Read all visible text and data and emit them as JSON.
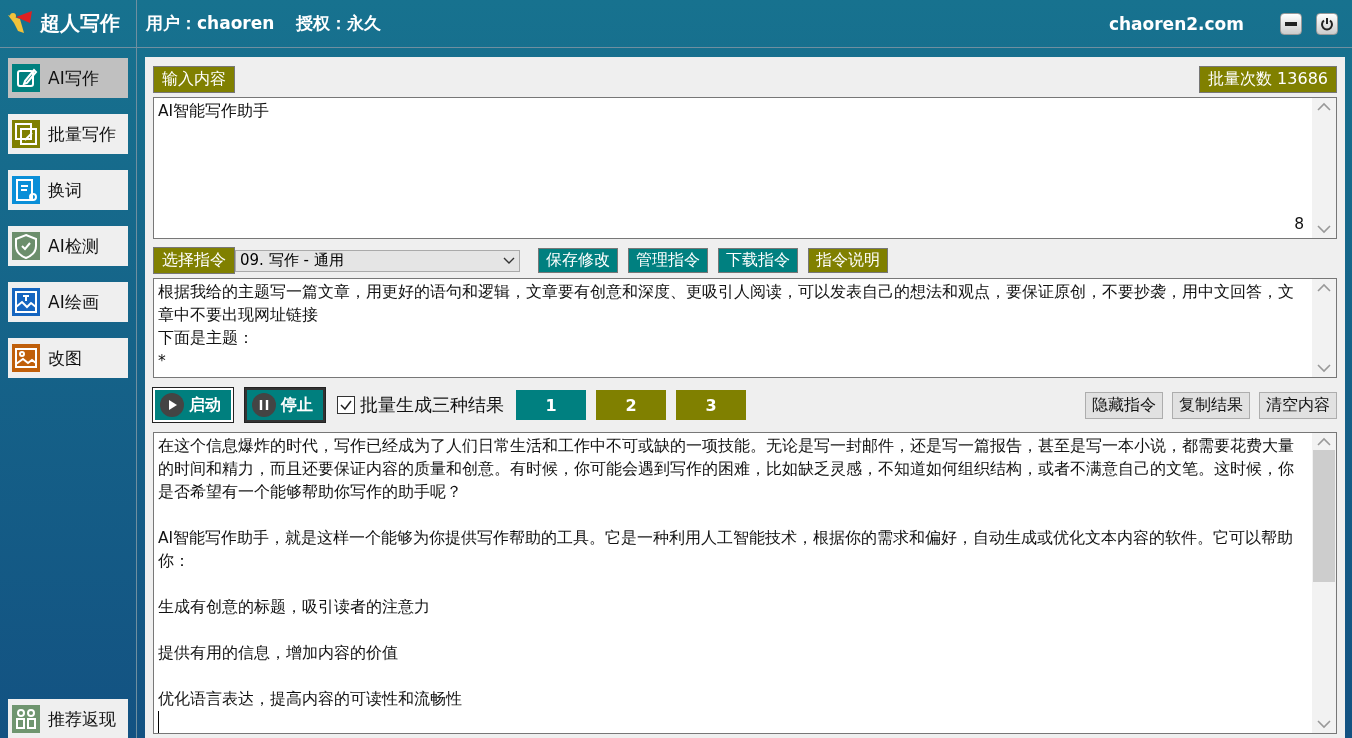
{
  "header": {
    "app_name": "超人写作",
    "user": "用户：chaoren",
    "license": "授权：永久",
    "site": "chaoren2.com"
  },
  "sidebar": {
    "items": [
      {
        "label": "AI写作",
        "kind": "edit",
        "color": "#00807f",
        "selected": true
      },
      {
        "label": "批量写作",
        "kind": "batch",
        "color": "#808000",
        "selected": false
      },
      {
        "label": "换词",
        "kind": "doc",
        "color": "#0a8fd8",
        "selected": false
      },
      {
        "label": "AI检测",
        "kind": "shield",
        "color": "#6c8e6c",
        "selected": false
      },
      {
        "label": "AI绘画",
        "kind": "paint",
        "color": "#1565c0",
        "selected": false
      },
      {
        "label": "改图",
        "kind": "image",
        "color": "#c05f0a",
        "selected": false
      }
    ],
    "footer_item": {
      "label": "推荐返现",
      "kind": "share",
      "color": "#6f956f",
      "selected": false
    }
  },
  "input": {
    "label": "输入内容",
    "batch_count": "批量次数 13686",
    "value": "AI智能写作助手",
    "char_count": "8"
  },
  "command": {
    "label": "选择指令",
    "selected_command": "09. 写作  - 通用",
    "buttons": [
      {
        "label": "保存修改",
        "kind": "teal"
      },
      {
        "label": "管理指令",
        "kind": "teal"
      },
      {
        "label": "下载指令",
        "kind": "teal"
      },
      {
        "label": "指令说明",
        "kind": "olive"
      }
    ],
    "prompt_lines": [
      "根据我给的主题写一篇文章，用更好的语句和逻辑，文章要有创意和深度、更吸引人阅读，可以发表自己的想法和观点，要保证原创，不要抄袭，用中文回答，文章中不要出现网址链接",
      "下面是主题：",
      "*"
    ]
  },
  "controls": {
    "start": "启动",
    "stop": "停止",
    "batch_three": {
      "label": "批量生成三种结果",
      "checked": true
    },
    "results": [
      {
        "label": "1",
        "selected": true
      },
      {
        "label": "2",
        "selected": false
      },
      {
        "label": "3",
        "selected": false
      }
    ],
    "actions": [
      "隐藏指令",
      "复制结果",
      "清空内容"
    ]
  },
  "output": {
    "paragraphs": [
      "在这个信息爆炸的时代，写作已经成为了人们日常生活和工作中不可或缺的一项技能。无论是写一封邮件，还是写一篇报告，甚至是写一本小说，都需要花费大量的时间和精力，而且还要保证内容的质量和创意。有时候，你可能会遇到写作的困难，比如缺乏灵感，不知道如何组织结构，或者不满意自己的文笔。这时候，你是否希望有一个能够帮助你写作的助手呢？",
      "AI智能写作助手，就是这样一个能够为你提供写作帮助的工具。它是一种利用人工智能技术，根据你的需求和偏好，自动生成或优化文本内容的软件。它可以帮助你：",
      "生成有创意的标题，吸引读者的注意力",
      "提供有用的信息，增加内容的价值",
      "优化语言表达，提高内容的可读性和流畅性"
    ]
  }
}
